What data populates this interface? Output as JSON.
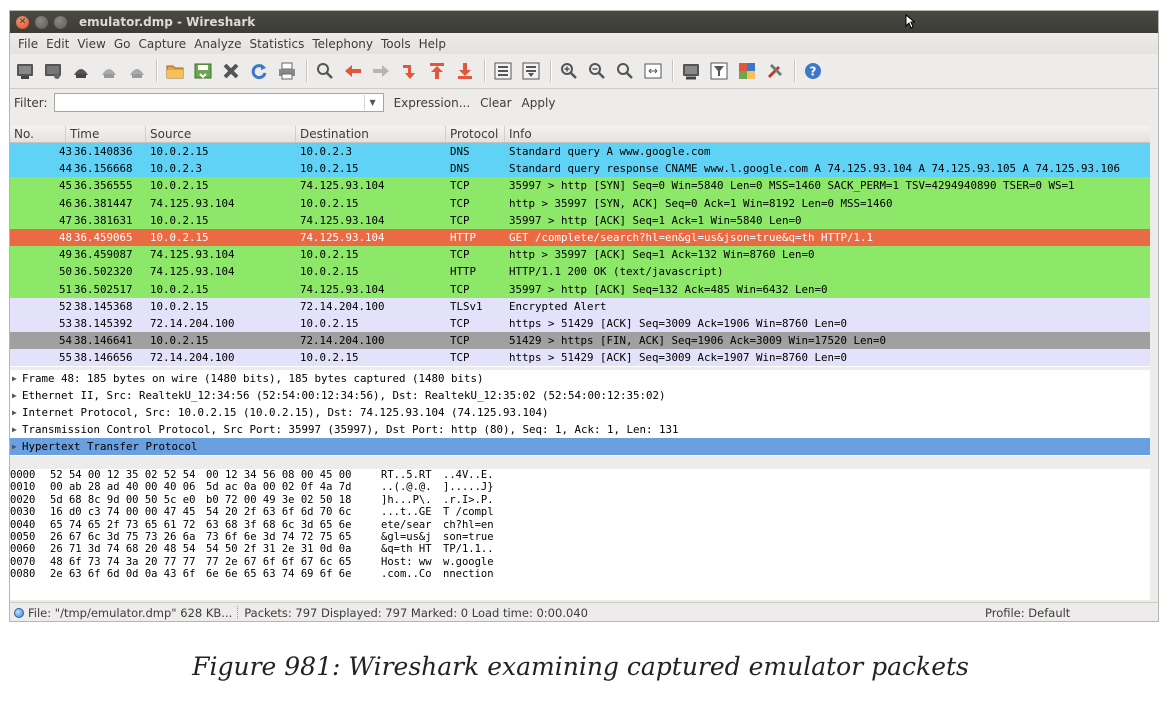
{
  "window": {
    "title": "emulator.dmp - Wireshark"
  },
  "menu": [
    "File",
    "Edit",
    "View",
    "Go",
    "Capture",
    "Analyze",
    "Statistics",
    "Telephony",
    "Tools",
    "Help"
  ],
  "toolbar": {
    "icons": [
      "interface-list-icon",
      "capture-options-icon",
      "start-capture-icon",
      "stop-capture-icon",
      "restart-capture-icon",
      "open-file-icon",
      "save-file-icon",
      "close-file-icon",
      "reload-icon",
      "print-icon",
      "find-packet-icon",
      "go-back-icon",
      "go-forward-icon",
      "go-to-packet-icon",
      "go-first-icon",
      "go-last-icon",
      "colorize-icon",
      "autoscroll-icon",
      "zoom-in-icon",
      "zoom-out-icon",
      "normal-size-icon",
      "resize-columns-icon",
      "capture-filters-icon",
      "display-filters-icon",
      "coloring-rules-icon",
      "preferences-icon",
      "help-icon"
    ],
    "colors": {
      "accent": "#3b78c5"
    }
  },
  "filter": {
    "label": "Filter:",
    "value": "",
    "expression": "Expression...",
    "clear": "Clear",
    "apply": "Apply"
  },
  "packet_list": {
    "columns": [
      "No.",
      "Time",
      "Source",
      "Destination",
      "Protocol",
      "Info"
    ],
    "rows": [
      {
        "no": "43",
        "time": "36.140836",
        "src": "10.0.2.15",
        "dst": "10.0.2.3",
        "proto": "DNS",
        "info": "Standard query A www.google.com",
        "bg": "#5fd2f5",
        "fg": "#000000"
      },
      {
        "no": "44",
        "time": "36.156668",
        "src": "10.0.2.3",
        "dst": "10.0.2.15",
        "proto": "DNS",
        "info": "Standard query response CNAME www.l.google.com A 74.125.93.104 A 74.125.93.105 A 74.125.93.106",
        "bg": "#5fd2f5",
        "fg": "#000000"
      },
      {
        "no": "45",
        "time": "36.356555",
        "src": "10.0.2.15",
        "dst": "74.125.93.104",
        "proto": "TCP",
        "info": "35997 > http [SYN] Seq=0 Win=5840 Len=0 MSS=1460 SACK_PERM=1 TSV=4294940890 TSER=0 WS=1",
        "bg": "#8de86a",
        "fg": "#000000"
      },
      {
        "no": "46",
        "time": "36.381447",
        "src": "74.125.93.104",
        "dst": "10.0.2.15",
        "proto": "TCP",
        "info": "http > 35997 [SYN, ACK] Seq=0 Ack=1 Win=8192 Len=0 MSS=1460",
        "bg": "#8de86a",
        "fg": "#000000"
      },
      {
        "no": "47",
        "time": "36.381631",
        "src": "10.0.2.15",
        "dst": "74.125.93.104",
        "proto": "TCP",
        "info": "35997 > http [ACK] Seq=1 Ack=1 Win=5840 Len=0",
        "bg": "#8de86a",
        "fg": "#000000"
      },
      {
        "no": "48",
        "time": "36.459065",
        "src": "10.0.2.15",
        "dst": "74.125.93.104",
        "proto": "HTTP",
        "info": "GET /complete/search?hl=en&gl=us&json=true&q=th HTTP/1.1",
        "bg": "#e96a43",
        "fg": "#ffffff"
      },
      {
        "no": "49",
        "time": "36.459087",
        "src": "74.125.93.104",
        "dst": "10.0.2.15",
        "proto": "TCP",
        "info": "http > 35997 [ACK] Seq=1 Ack=132 Win=8760 Len=0",
        "bg": "#8de86a",
        "fg": "#000000"
      },
      {
        "no": "50",
        "time": "36.502320",
        "src": "74.125.93.104",
        "dst": "10.0.2.15",
        "proto": "HTTP",
        "info": "HTTP/1.1 200 OK  (text/javascript)",
        "bg": "#8de86a",
        "fg": "#000000"
      },
      {
        "no": "51",
        "time": "36.502517",
        "src": "10.0.2.15",
        "dst": "74.125.93.104",
        "proto": "TCP",
        "info": "35997 > http [ACK] Seq=132 Ack=485 Win=6432 Len=0",
        "bg": "#8de86a",
        "fg": "#000000"
      },
      {
        "no": "52",
        "time": "38.145368",
        "src": "10.0.2.15",
        "dst": "72.14.204.100",
        "proto": "TLSv1",
        "info": "Encrypted Alert",
        "bg": "#e4e2fa",
        "fg": "#000000"
      },
      {
        "no": "53",
        "time": "38.145392",
        "src": "72.14.204.100",
        "dst": "10.0.2.15",
        "proto": "TCP",
        "info": "https > 51429 [ACK] Seq=3009 Ack=1906 Win=8760 Len=0",
        "bg": "#e4e2fa",
        "fg": "#000000"
      },
      {
        "no": "54",
        "time": "38.146641",
        "src": "10.0.2.15",
        "dst": "72.14.204.100",
        "proto": "TCP",
        "info": "51429 > https [FIN, ACK] Seq=1906 Ack=3009 Win=17520 Len=0",
        "bg": "#a0a0a0",
        "fg": "#000000"
      },
      {
        "no": "55",
        "time": "38.146656",
        "src": "72.14.204.100",
        "dst": "10.0.2.15",
        "proto": "TCP",
        "info": "https > 51429 [ACK] Seq=3009 Ack=1907 Win=8760 Len=0",
        "bg": "#e4e2fa",
        "fg": "#000000"
      }
    ]
  },
  "details": [
    {
      "text": "Frame 48: 185 bytes on wire (1480 bits), 185 bytes captured (1480 bits)",
      "selected": false
    },
    {
      "text": "Ethernet II, Src: RealtekU_12:34:56 (52:54:00:12:34:56), Dst: RealtekU_12:35:02 (52:54:00:12:35:02)",
      "selected": false
    },
    {
      "text": "Internet Protocol, Src: 10.0.2.15 (10.0.2.15), Dst: 74.125.93.104 (74.125.93.104)",
      "selected": false
    },
    {
      "text": "Transmission Control Protocol, Src Port: 35997 (35997), Dst Port: http (80), Seq: 1, Ack: 1, Len: 131",
      "selected": false
    },
    {
      "text": "Hypertext Transfer Protocol",
      "selected": true
    }
  ],
  "hex": [
    {
      "off": "0000",
      "b1": "52 54 00 12 35 02 52 54",
      "b2": "00 12 34 56 08 00 45 00",
      "a1": "RT..5.RT",
      "a2": "..4V..E."
    },
    {
      "off": "0010",
      "b1": "00 ab 28 ad 40 00 40 06",
      "b2": "5d ac 0a 00 02 0f 4a 7d",
      "a1": "..(.@.@.",
      "a2": "].....J}"
    },
    {
      "off": "0020",
      "b1": "5d 68 8c 9d 00 50 5c e0",
      "b2": "b0 72 00 49 3e 02 50 18",
      "a1": "]h...P\\.",
      "a2": ".r.I>.P."
    },
    {
      "off": "0030",
      "b1": "16 d0 c3 74 00 00 47 45",
      "b2": "54 20 2f 63 6f 6d 70 6c",
      "a1": "...t..GE",
      "a2": "T /compl"
    },
    {
      "off": "0040",
      "b1": "65 74 65 2f 73 65 61 72",
      "b2": "63 68 3f 68 6c 3d 65 6e",
      "a1": "ete/sear",
      "a2": "ch?hl=en"
    },
    {
      "off": "0050",
      "b1": "26 67 6c 3d 75 73 26 6a",
      "b2": "73 6f 6e 3d 74 72 75 65",
      "a1": "&gl=us&j",
      "a2": "son=true"
    },
    {
      "off": "0060",
      "b1": "26 71 3d 74 68 20 48 54",
      "b2": "54 50 2f 31 2e 31 0d 0a",
      "a1": "&q=th HT",
      "a2": "TP/1.1.."
    },
    {
      "off": "0070",
      "b1": "48 6f 73 74 3a 20 77 77",
      "b2": "77 2e 67 6f 6f 67 6c 65",
      "a1": "Host: ww",
      "a2": "w.google"
    },
    {
      "off": "0080",
      "b1": "2e 63 6f 6d 0d 0a 43 6f",
      "b2": "6e 6e 65 63 74 69 6f 6e",
      "a1": ".com..Co",
      "a2": "nnection"
    }
  ],
  "status": {
    "file": "File: \"/tmp/emulator.dmp\" 628 KB...",
    "packets": "Packets: 797 Displayed: 797 Marked: 0 Load time: 0:00.040",
    "profile": "Profile: Default"
  },
  "caption": "Figure 981: Wireshark examining captured emulator packets"
}
